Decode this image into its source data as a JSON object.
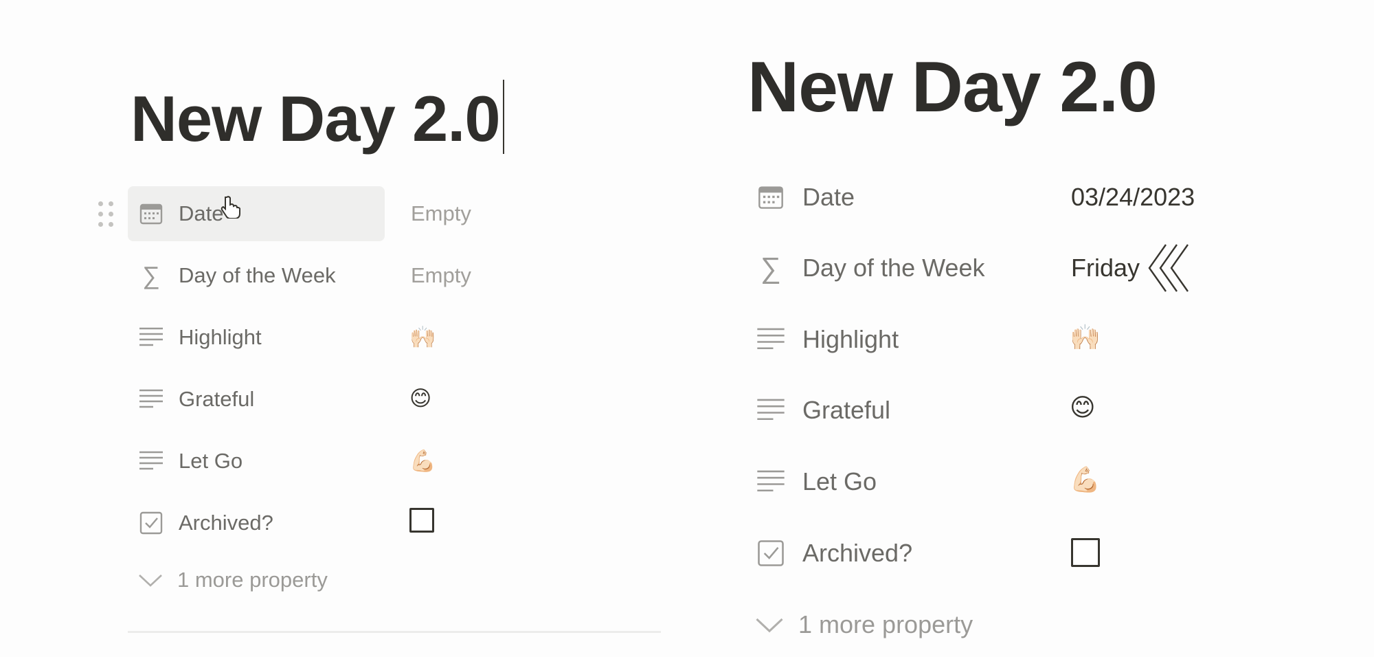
{
  "left": {
    "title": "New Day 2.0",
    "properties": [
      {
        "icon": "calendar-icon",
        "label": "Date",
        "value": "Empty"
      },
      {
        "icon": "sigma-icon",
        "label": "Day of the Week",
        "value": "Empty"
      },
      {
        "icon": "text-lines-icon",
        "label": "Highlight",
        "value": "🙌🏻"
      },
      {
        "icon": "text-lines-icon",
        "label": "Grateful",
        "value": "😊"
      },
      {
        "icon": "text-lines-icon",
        "label": "Let Go",
        "value": "💪🏻"
      },
      {
        "icon": "checkbox-icon",
        "label": "Archived?",
        "value_checked": false
      }
    ],
    "more_label": "1 more property"
  },
  "right": {
    "title": "New Day 2.0",
    "properties": [
      {
        "icon": "calendar-icon",
        "label": "Date",
        "value": "03/24/2023"
      },
      {
        "icon": "sigma-icon",
        "label": "Day of the Week",
        "value": "Friday"
      },
      {
        "icon": "text-lines-icon",
        "label": "Highlight",
        "value": "🙌🏻"
      },
      {
        "icon": "text-lines-icon",
        "label": "Grateful",
        "value": "😊"
      },
      {
        "icon": "text-lines-icon",
        "label": "Let Go",
        "value": "💪🏻"
      },
      {
        "icon": "checkbox-icon",
        "label": "Archived?",
        "value_checked": false
      }
    ],
    "more_label": "1 more property"
  },
  "colors": {
    "text_dark": "#37352f",
    "text_muted": "#6b6a66",
    "icon_gray": "#9b9a97",
    "hover_bg": "#efefee"
  }
}
